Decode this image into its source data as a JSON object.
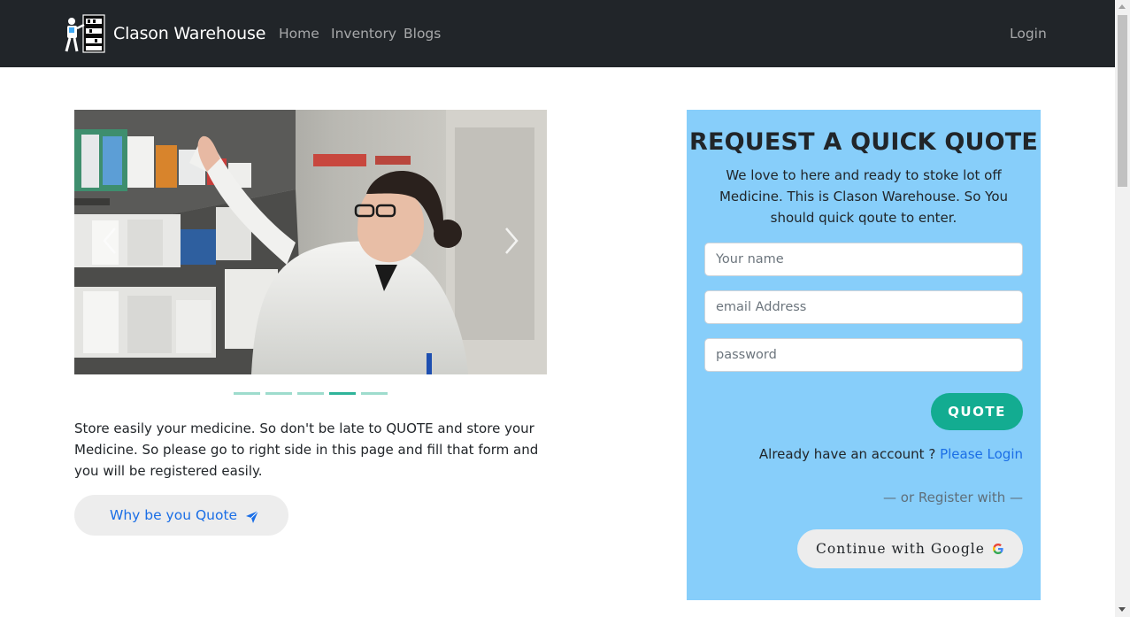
{
  "navbar": {
    "brand": "Clason Warehouse",
    "links": [
      "Home",
      "Inventory",
      "Blogs"
    ],
    "login": "Login"
  },
  "carousel": {
    "slide_count": 5,
    "active_slide": 4
  },
  "intro": {
    "text": "Store easily your medicine. So don't be late to QUOTE and store your Medicine. So please go to right side in this page and fill that form and you will be registered easily.",
    "button_label": "Why be you Quote"
  },
  "quote_form": {
    "title": "REQUEST A QUICK QUOTE",
    "description": "We love to here and ready to stoke lot off Medicine. This is Clason Warehouse. So You should quick qoute to enter.",
    "name_placeholder": "Your name",
    "email_placeholder": "email Address",
    "password_placeholder": "password",
    "quote_button": "QUOTE",
    "account_text": "Already have an account ?",
    "login_link": "Please Login",
    "register_text": "— or Register with —",
    "google_button": "Continue with Google"
  },
  "colors": {
    "navbar_bg": "#212529",
    "card_bg": "#87cefa",
    "accent": "#13ac91",
    "link": "#1a6ee6"
  }
}
